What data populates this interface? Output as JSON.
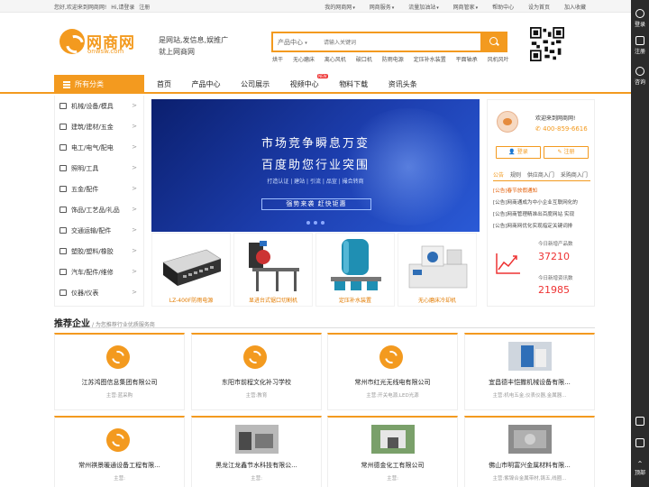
{
  "topbar": {
    "welcome": "您好,欢迎来到网商网!",
    "login": "Hi,请登录",
    "register": "注册",
    "links": [
      "我的网商网",
      "网商服务",
      "流量加油站",
      "网商管家",
      "帮助中心",
      "设为首页",
      "加入收藏"
    ]
  },
  "logo": {
    "name": "网商网",
    "domain": "onwsw.com"
  },
  "slogan": {
    "line1": "是网站,发信息,娱推广",
    "line2": "就上网商网"
  },
  "search": {
    "category": "产品中心",
    "placeholder": "请输入关键词"
  },
  "hot_keywords": [
    "烘干",
    "无心磨床",
    "离心风机",
    "破口机",
    "防雨电源",
    "定压补水装置",
    "平面轴承",
    "风机风叶"
  ],
  "nav": {
    "all_categories": "所有分类",
    "items": [
      "首页",
      "产品中心",
      "公司展示",
      "视频中心",
      "物料下载",
      "资讯头条"
    ],
    "new_badge": "NEW"
  },
  "categories": [
    "机械/设备/模具",
    "建筑/建材/五金",
    "电工/电气/配电",
    "照明/工具",
    "五金/配件",
    "饰品/工艺品/礼品",
    "交通运输/配件",
    "塑胶/塑料/橡胶",
    "汽车/配件/维修",
    "仪器/仪表"
  ],
  "banner": {
    "line1": "市场竞争瞬息万变",
    "line2": "百度助您行业突围",
    "sub": "打造认证 | 建站 | 引流 | 品宣 | 撮合转商",
    "cta": "强势来袭 赶快钜惠"
  },
  "products": [
    "LZ-400F防雨电源",
    "显进台式锯口切割机",
    "定压补水装置",
    "无心磨床冷却机"
  ],
  "side": {
    "welcome": "欢迎来到网商网!",
    "phone": "400-859-6616",
    "login": "登录",
    "register": "注册",
    "tabs": [
      "公告",
      "规则",
      "供应商入门",
      "采购商入门"
    ],
    "news": [
      "[公告]春节放假通知",
      "[公告]网商通成为中小企业互联网化的",
      "[公告]网商管理精准出百度网站 实现",
      "[公告]网商网优化实现指定关键词排"
    ],
    "stats": [
      {
        "label": "今日新增产品数",
        "value": "37210"
      },
      {
        "label": "今日新增资讯数",
        "value": "21985"
      }
    ]
  },
  "recommend": {
    "title": "推荐企业",
    "subtitle": "/ 为您推荐行业优质服务商"
  },
  "companies": [
    {
      "name": "江苏鸿图信息集团有限公司",
      "main": "主营:蓝采购"
    },
    {
      "name": "东阳市前程文化补习学校",
      "main": "主营:教育"
    },
    {
      "name": "常州市红光无线电有限公司",
      "main": "主营:开关电源,LED光源"
    },
    {
      "name": "宜昌德丰恺撒机械设备有限...",
      "main": "主营:机电五金,仪表仪器,金属器..."
    },
    {
      "name": "常州祺景暖通设备工程有限...",
      "main": "主营:"
    },
    {
      "name": "黑龙江龙鑫节水科技有限公...",
      "main": "主营:"
    },
    {
      "name": "常州德金化工有限公司",
      "main": "主营:"
    },
    {
      "name": "佛山市明富兴金属材料有限...",
      "main": "主营:紫镍合金属带材,铸五,线圈..."
    }
  ],
  "rail": [
    "登录",
    "注册",
    "咨询",
    "顶部"
  ]
}
